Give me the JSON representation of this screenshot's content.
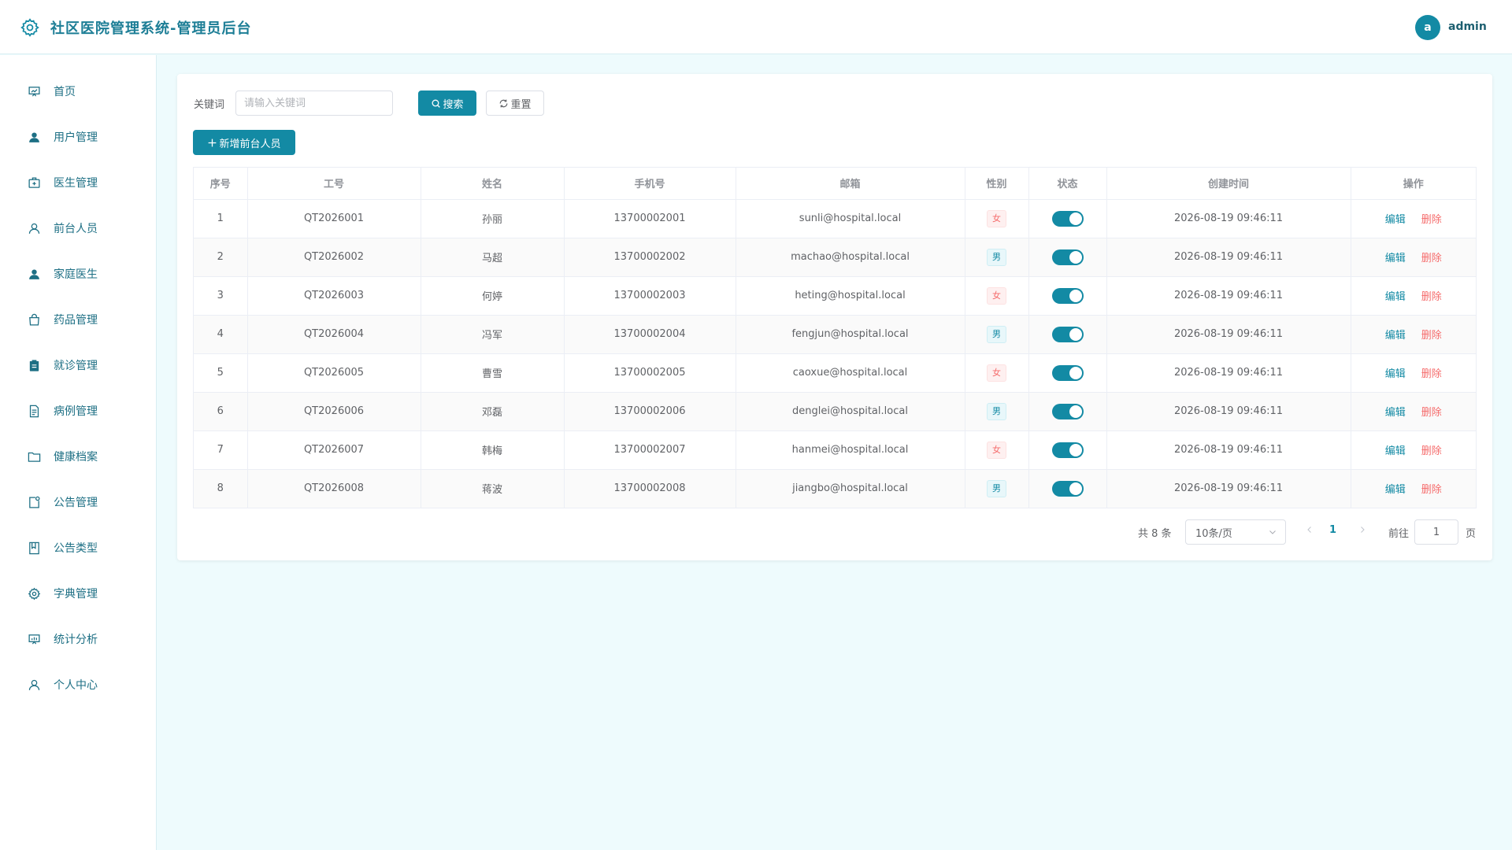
{
  "app": {
    "title": "社区医院管理系统-管理员后台",
    "user_initial": "a",
    "user_name": "admin",
    "accent_color": "#138aa4"
  },
  "sidebar": {
    "items": [
      {
        "label": "首页",
        "icon": "presentation-icon"
      },
      {
        "label": "用户管理",
        "icon": "user-filled-icon"
      },
      {
        "label": "医生管理",
        "icon": "first-aid-kit-icon"
      },
      {
        "label": "前台人员",
        "icon": "user-outline-icon"
      },
      {
        "label": "家庭医生",
        "icon": "user-filled-icon"
      },
      {
        "label": "药品管理",
        "icon": "shopping-bag-icon"
      },
      {
        "label": "就诊管理",
        "icon": "clipboard-icon"
      },
      {
        "label": "病例管理",
        "icon": "document-icon"
      },
      {
        "label": "健康档案",
        "icon": "folder-icon"
      },
      {
        "label": "公告管理",
        "icon": "notice-icon"
      },
      {
        "label": "公告类型",
        "icon": "notebook-icon"
      },
      {
        "label": "字典管理",
        "icon": "setting-icon"
      },
      {
        "label": "统计分析",
        "icon": "data-board-icon"
      },
      {
        "label": "个人中心",
        "icon": "user-outline-icon"
      }
    ]
  },
  "search": {
    "label": "关键词",
    "placeholder": "请输入关键词",
    "value": "",
    "search_button": "搜索",
    "reset_button": "重置"
  },
  "toolbar": {
    "add_button": "新增前台人员"
  },
  "table": {
    "columns": [
      "序号",
      "工号",
      "姓名",
      "手机号",
      "邮箱",
      "性别",
      "状态",
      "创建时间",
      "操作"
    ],
    "edit_label": "编辑",
    "delete_label": "删除",
    "rows": [
      {
        "index": "1",
        "emp_no": "QT2026001",
        "name": "孙丽",
        "phone": "13700002001",
        "email": "sunli@hospital.local",
        "gender": "女",
        "status": true,
        "created": "2026-08-19 09:46:11"
      },
      {
        "index": "2",
        "emp_no": "QT2026002",
        "name": "马超",
        "phone": "13700002002",
        "email": "machao@hospital.local",
        "gender": "男",
        "status": true,
        "created": "2026-08-19 09:46:11"
      },
      {
        "index": "3",
        "emp_no": "QT2026003",
        "name": "何婷",
        "phone": "13700002003",
        "email": "heting@hospital.local",
        "gender": "女",
        "status": true,
        "created": "2026-08-19 09:46:11"
      },
      {
        "index": "4",
        "emp_no": "QT2026004",
        "name": "冯军",
        "phone": "13700002004",
        "email": "fengjun@hospital.local",
        "gender": "男",
        "status": true,
        "created": "2026-08-19 09:46:11"
      },
      {
        "index": "5",
        "emp_no": "QT2026005",
        "name": "曹雪",
        "phone": "13700002005",
        "email": "caoxue@hospital.local",
        "gender": "女",
        "status": true,
        "created": "2026-08-19 09:46:11"
      },
      {
        "index": "6",
        "emp_no": "QT2026006",
        "name": "邓磊",
        "phone": "13700002006",
        "email": "denglei@hospital.local",
        "gender": "男",
        "status": true,
        "created": "2026-08-19 09:46:11"
      },
      {
        "index": "7",
        "emp_no": "QT2026007",
        "name": "韩梅",
        "phone": "13700002007",
        "email": "hanmei@hospital.local",
        "gender": "女",
        "status": true,
        "created": "2026-08-19 09:46:11"
      },
      {
        "index": "8",
        "emp_no": "QT2026008",
        "name": "蒋波",
        "phone": "13700002008",
        "email": "jiangbo@hospital.local",
        "gender": "男",
        "status": true,
        "created": "2026-08-19 09:46:11"
      }
    ]
  },
  "pagination": {
    "total_text": "共 8 条",
    "page_size": "10条/页",
    "current_page": "1",
    "goto_label": "前往",
    "goto_value": "1",
    "page_unit": "页"
  }
}
